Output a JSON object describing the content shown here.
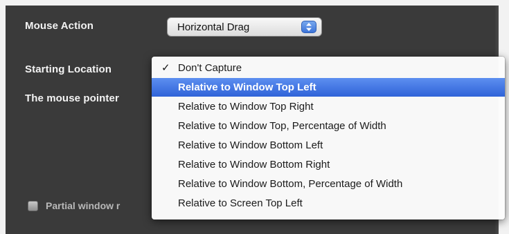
{
  "labels": {
    "mouse_action": "Mouse Action",
    "starting_location": "Starting Location",
    "mouse_pointer": "The mouse pointer",
    "partial_window": "Partial window r"
  },
  "popup": {
    "value": "Horizontal Drag",
    "stepper_icon": "up-down-arrows-icon"
  },
  "menu": {
    "check_glyph": "✓",
    "items": [
      {
        "label": "Don't Capture",
        "checked": true,
        "highlighted": false
      },
      {
        "label": "Relative to Window Top Left",
        "checked": false,
        "highlighted": true
      },
      {
        "label": "Relative to Window Top Right",
        "checked": false,
        "highlighted": false
      },
      {
        "label": "Relative to Window Top, Percentage of Width",
        "checked": false,
        "highlighted": false
      },
      {
        "label": "Relative to Window Bottom Left",
        "checked": false,
        "highlighted": false
      },
      {
        "label": "Relative to Window Bottom Right",
        "checked": false,
        "highlighted": false
      },
      {
        "label": "Relative to Window Bottom, Percentage of Width",
        "checked": false,
        "highlighted": false
      },
      {
        "label": "Relative to Screen Top Left",
        "checked": false,
        "highlighted": false
      }
    ]
  },
  "colors": {
    "panel_bg": "#3a3a3a",
    "highlight": "#3f72e0",
    "label_text": "#f3f3f3"
  }
}
